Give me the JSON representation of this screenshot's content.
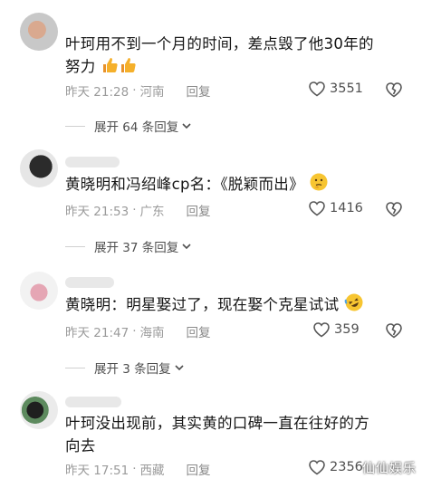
{
  "comments": [
    {
      "text": "叶珂用不到一个月的时间，差点毁了他30年的努力",
      "text_line1": "叶珂用不到一个月的时间，差点毁了他30年的",
      "text_line2": "努力",
      "emoji": [
        "thumbs-up",
        "thumbs-up"
      ],
      "time": "昨天 21:28",
      "location": "河南",
      "reply_label": "回复",
      "likes": "3551",
      "expand_label": "展开 64 条回复"
    },
    {
      "text": "黄晓明和冯绍峰cp名：《脱颖而出》",
      "emoji": [
        "thinking-face"
      ],
      "time": "昨天 21:53",
      "location": "广东",
      "reply_label": "回复",
      "likes": "1416",
      "expand_label": "展开 37 条回复"
    },
    {
      "text": "黄晓明：明星娶过了，现在娶个克星试试",
      "emoji": [
        "rolling-laughing-face"
      ],
      "time": "昨天 21:47",
      "location": "海南",
      "reply_label": "回复",
      "likes": "359",
      "expand_label": "展开 3 条回复"
    },
    {
      "text": "叶珂没出现前，其实黄的口碑一直在往好的方向去",
      "text_line1": "叶珂没出现前，其实黄的口碑一直在往好的方",
      "text_line2": "向去",
      "time": "昨天 17:51",
      "location": "西藏",
      "reply_label": "回复",
      "likes": "2356"
    }
  ],
  "separator": "·",
  "watermark": "仙仙娱乐",
  "colors": {
    "text": "#161616",
    "meta": "#9b9b9b",
    "thumbs": "#f5a623"
  }
}
